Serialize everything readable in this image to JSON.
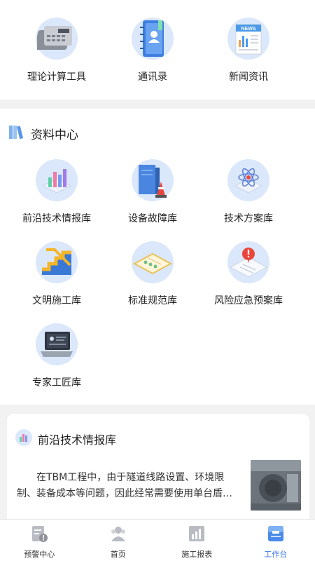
{
  "tools": [
    {
      "label": "理论计算工具",
      "icon": "calculator-icon"
    },
    {
      "label": "通讯录",
      "icon": "address-book-icon"
    },
    {
      "label": "新闻资讯",
      "icon": "newspaper-icon",
      "badge": "NEWS"
    }
  ],
  "library": {
    "title": "资料中心",
    "icon": "books-icon",
    "items": [
      {
        "label": "前沿技术情报库",
        "icon": "bar-chart-icon"
      },
      {
        "label": "设备故障库",
        "icon": "server-warning-icon"
      },
      {
        "label": "技术方案库",
        "icon": "atom-icon"
      },
      {
        "label": "文明施工库",
        "icon": "stairs-icon"
      },
      {
        "label": "标准规范库",
        "icon": "document-icon"
      },
      {
        "label": "风险应急预案库",
        "icon": "alert-report-icon"
      },
      {
        "label": "专家工匠库",
        "icon": "laptop-profile-icon"
      }
    ]
  },
  "news_card": {
    "title": "前沿技术情报库",
    "text": "在TBM工程中，由于隧道线路设置、环境限制、装备成本等问题，因此经常需要使用单台盾…"
  },
  "tabbar": {
    "items": [
      {
        "label": "预警中心",
        "icon": "warning-doc-icon",
        "active": false
      },
      {
        "label": "首页",
        "icon": "home-user-icon",
        "active": false
      },
      {
        "label": "施工报表",
        "icon": "report-chart-icon",
        "active": false
      },
      {
        "label": "工作台",
        "icon": "workbench-icon",
        "active": true
      }
    ]
  },
  "colors": {
    "accent": "#3b7be8",
    "icon_bg": "#dbe7fa",
    "page_bg": "#f2f2f2"
  }
}
